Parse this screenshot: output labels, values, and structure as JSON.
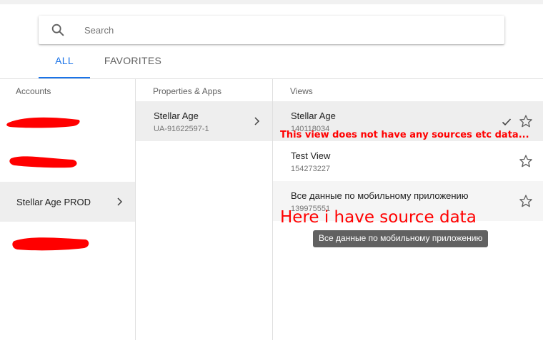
{
  "search": {
    "placeholder": "Search",
    "value": ""
  },
  "tabs": [
    {
      "label": "ALL",
      "active": true
    },
    {
      "label": "FAVORITES",
      "active": false
    }
  ],
  "columns": {
    "accounts": {
      "header": "Accounts",
      "items": [
        {
          "label": "",
          "redacted": true
        },
        {
          "label": "",
          "redacted": true
        },
        {
          "label": "Stellar Age PROD",
          "selected": true
        },
        {
          "label": "",
          "redacted": true
        }
      ]
    },
    "properties": {
      "header": "Properties & Apps",
      "items": [
        {
          "title": "Stellar Age",
          "id": "UA-91622597-1",
          "selected": true
        }
      ]
    },
    "views": {
      "header": "Views",
      "items": [
        {
          "title": "Stellar Age",
          "id": "140118034",
          "selected": true,
          "checked": true
        },
        {
          "title": "Test View",
          "id": "154273227"
        },
        {
          "title": "Все данные по мобильному приложению",
          "id": "139975551",
          "hover": true
        }
      ]
    }
  },
  "annotations": {
    "note_1": "This view does not have any sources etc data...",
    "note_2": "Here i have source data"
  },
  "tooltip": "Все данные по мобильному приложению",
  "colors": {
    "accent": "#1a73e8",
    "annotation": "#ff0000",
    "selected_row": "#eeeeee",
    "tooltip_bg": "#616161"
  },
  "icons": {
    "search": "search-icon",
    "chevron": "chevron-right-icon",
    "star": "star-outline-icon",
    "check": "checkmark-icon"
  }
}
